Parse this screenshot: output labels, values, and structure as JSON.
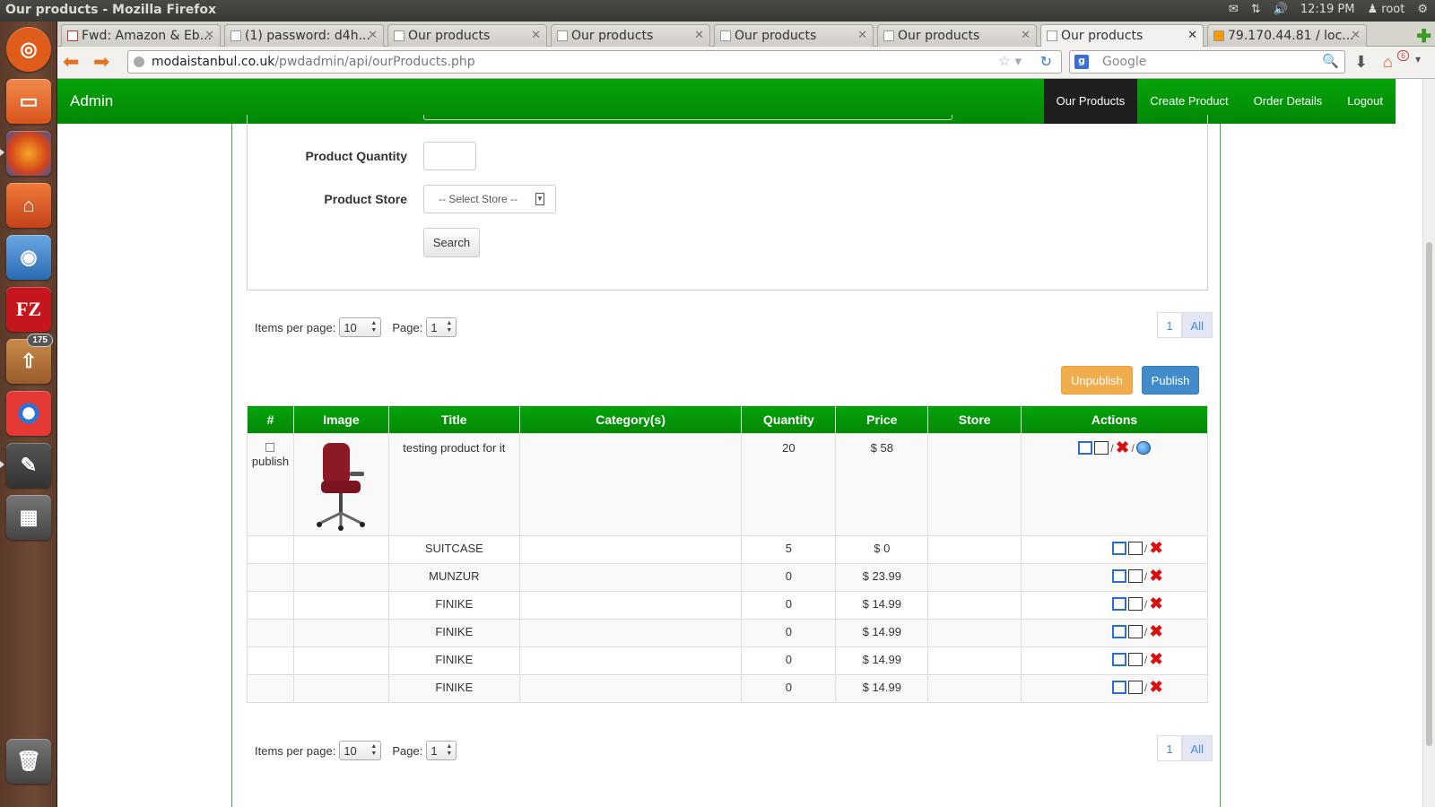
{
  "window_title": "Our products - Mozilla Firefox",
  "tray": {
    "time": "12:19 PM",
    "user": "root"
  },
  "launcher": {
    "badge": "175"
  },
  "tabs": [
    {
      "label": "Fwd: Amazon & Eb..."
    },
    {
      "label": "(1) password: d4h..."
    },
    {
      "label": "Our products"
    },
    {
      "label": "Our products"
    },
    {
      "label": "Our products"
    },
    {
      "label": "Our products"
    },
    {
      "label": "Our products"
    },
    {
      "label": "79.170.44.81 / loc..."
    }
  ],
  "url": {
    "domain": "modaistanbul.co.uk",
    "path": "/pwdadmin/api/ourProducts.php"
  },
  "search": {
    "placeholder": "Google"
  },
  "home_badge": "6",
  "admin": {
    "brand": "Admin",
    "nav": [
      "Our Products",
      "Create Product",
      "Order Details",
      "Logout"
    ]
  },
  "form": {
    "quantity_label": "Product Quantity",
    "store_label": "Product Store",
    "store_select": "-- Select Store --",
    "search_button": "Search"
  },
  "pager": {
    "items_label": "Items per page:",
    "items_value": "10",
    "page_label": "Page:",
    "page_value": "1",
    "link_page": "1",
    "link_all": "All"
  },
  "buttons": {
    "unpublish": "Unpublish",
    "publish": "Publish"
  },
  "table": {
    "headers": [
      "#",
      "Image",
      "Title",
      "Category(s)",
      "Quantity",
      "Price",
      "Store",
      "Actions"
    ],
    "publish_label": "publish",
    "rows": [
      {
        "title": "testing product for it",
        "category": "",
        "quantity": "20",
        "price": "$ 58",
        "store": ""
      },
      {
        "title": "SUITCASE",
        "category": "",
        "quantity": "5",
        "price": "$ 0",
        "store": ""
      },
      {
        "title": "MUNZUR",
        "category": "",
        "quantity": "0",
        "price": "$ 23.99",
        "store": ""
      },
      {
        "title": "FINIKE",
        "category": "",
        "quantity": "0",
        "price": "$ 14.99",
        "store": ""
      },
      {
        "title": "FINIKE",
        "category": "",
        "quantity": "0",
        "price": "$ 14.99",
        "store": ""
      },
      {
        "title": "FINIKE",
        "category": "",
        "quantity": "0",
        "price": "$ 14.99",
        "store": ""
      },
      {
        "title": "FINIKE",
        "category": "",
        "quantity": "0",
        "price": "$ 14.99",
        "store": ""
      }
    ]
  }
}
